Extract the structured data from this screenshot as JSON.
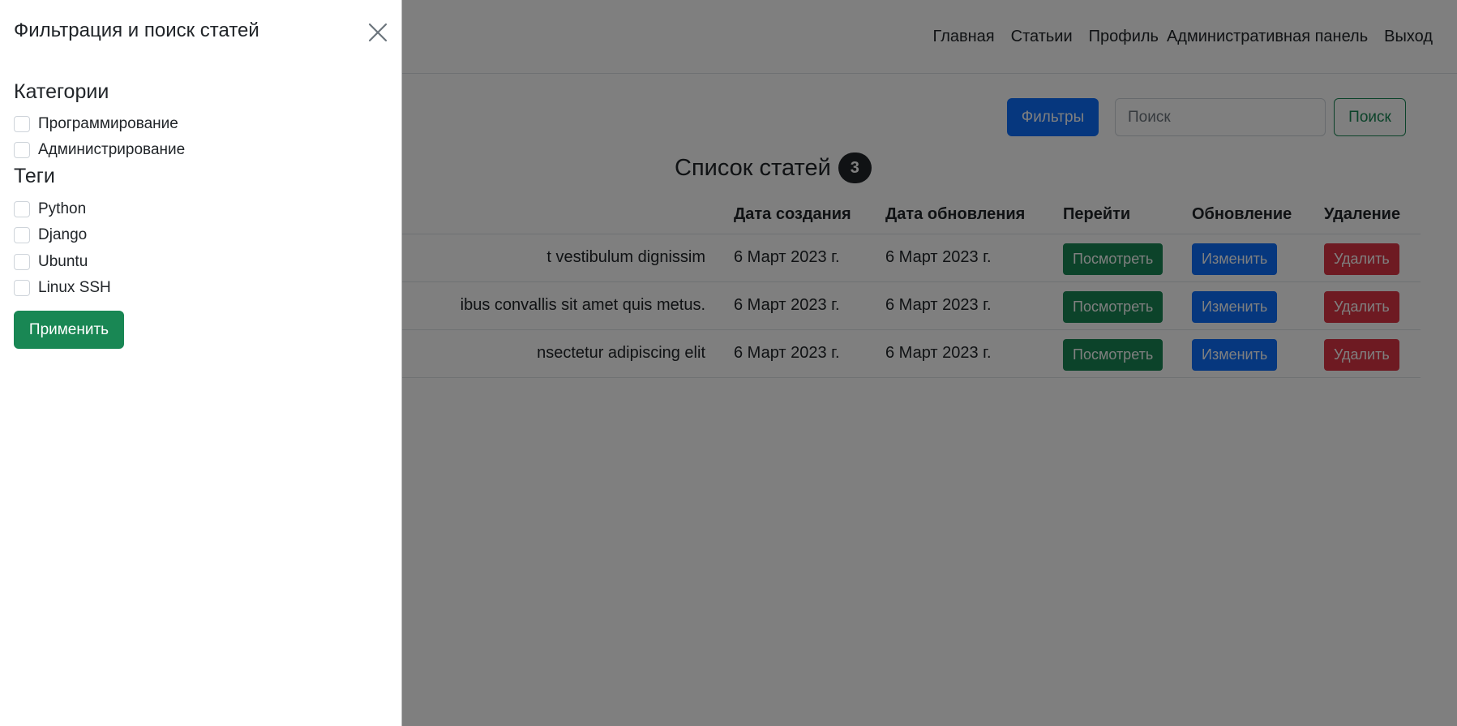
{
  "navbar": {
    "links": [
      "Главная",
      "Статьии",
      "Профиль",
      "Административная панель",
      "Выход"
    ]
  },
  "toolbar": {
    "filters_label": "Фильтры",
    "search_placeholder": "Поиск",
    "search_value": "",
    "search_button_label": "Поиск"
  },
  "list": {
    "title": "Список статей",
    "count": "3"
  },
  "table": {
    "headers": {
      "created": "Дата создания",
      "updated": "Дата обновления",
      "view": "Перейти",
      "edit": "Обновление",
      "delete": "Удаление"
    },
    "rows": [
      {
        "title": "t vestibulum dignissim",
        "created": "6 Март 2023 г.",
        "updated": "6 Март 2023 г.",
        "view": "Посмотреть",
        "edit": "Изменить",
        "delete": "Удалить"
      },
      {
        "title": "ibus convallis sit amet quis metus.",
        "created": "6 Март 2023 г.",
        "updated": "6 Март 2023 г.",
        "view": "Посмотреть",
        "edit": "Изменить",
        "delete": "Удалить"
      },
      {
        "title": "nsectetur adipiscing elit",
        "created": "6 Март 2023 г.",
        "updated": "6 Март 2023 г.",
        "view": "Посмотреть",
        "edit": "Изменить",
        "delete": "Удалить"
      }
    ]
  },
  "offcanvas": {
    "title": "Фильтрация и поиск статей",
    "close_icon": "close-icon",
    "categories_heading": "Категории",
    "categories": [
      {
        "label": "Программирование",
        "checked": false
      },
      {
        "label": "Администрирование",
        "checked": false
      }
    ],
    "tags_heading": "Теги",
    "tags": [
      {
        "label": "Python",
        "checked": false
      },
      {
        "label": "Django",
        "checked": false
      },
      {
        "label": "Ubuntu",
        "checked": false
      },
      {
        "label": "Linux SSH",
        "checked": false
      }
    ],
    "apply_label": "Применить"
  },
  "colors": {
    "primary": "#0d6efd",
    "success": "#198754",
    "danger": "#dc3545",
    "dark": "#212529",
    "backdrop": "rgba(0,0,0,0.5)"
  }
}
